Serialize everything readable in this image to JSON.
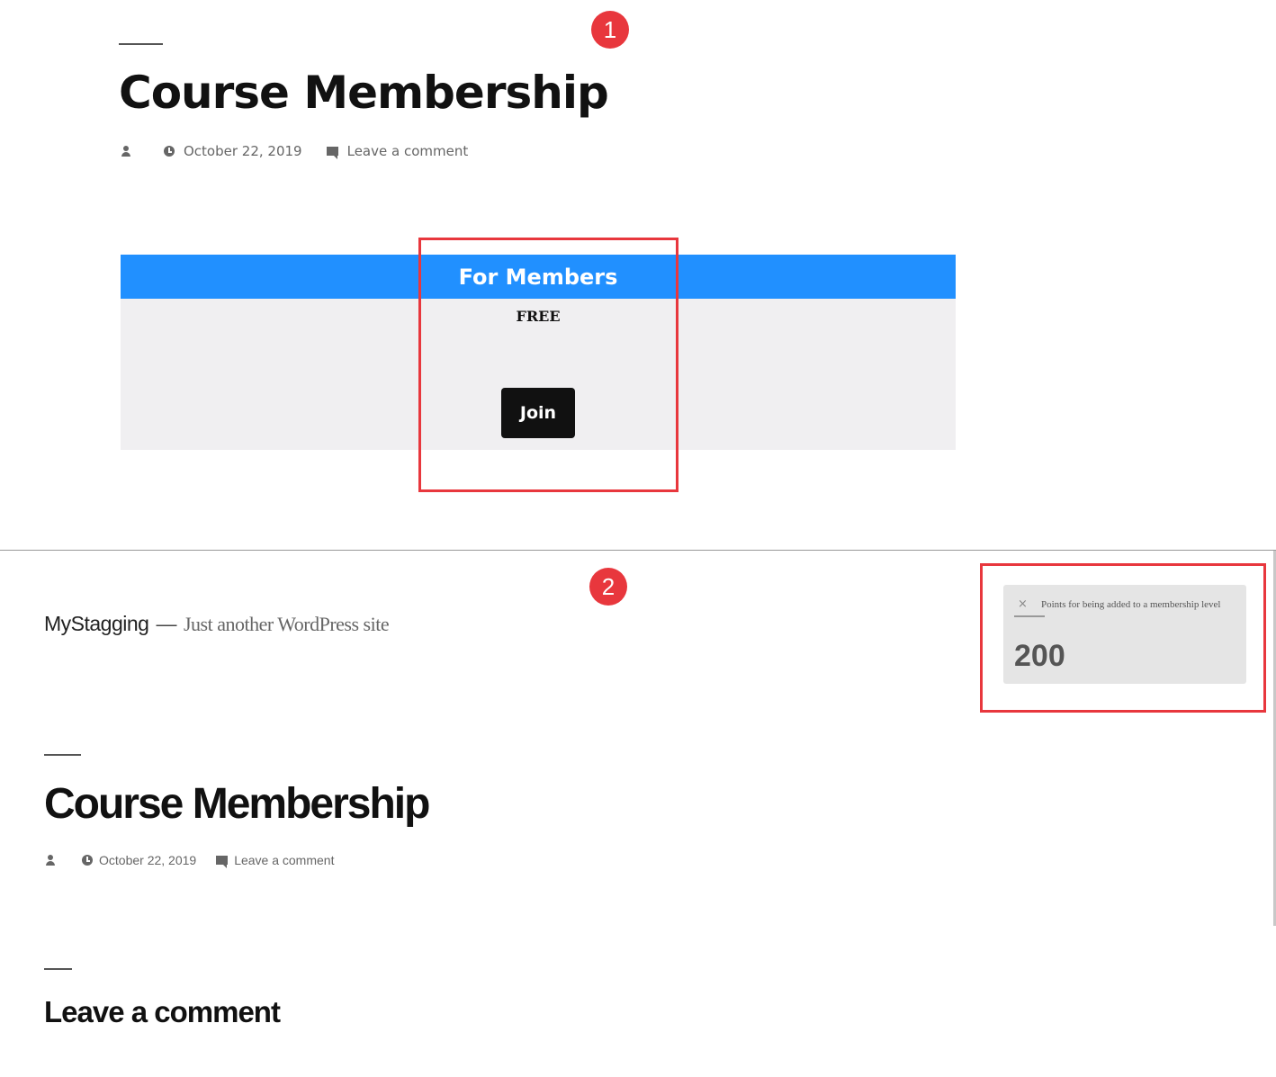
{
  "top_post": {
    "title": "Course Membership",
    "meta": {
      "date": "October 22, 2019",
      "comment_link": "Leave a comment"
    }
  },
  "membership_level": {
    "heading": "For Members",
    "price": "FREE",
    "join_label": "Join"
  },
  "callouts": {
    "first": "1",
    "second": "2"
  },
  "site": {
    "name": "MyStagging",
    "separator": "—",
    "tagline": "Just another WordPress site"
  },
  "points_notice": {
    "close_symbol": "×",
    "message": "Points for being added to a membership level",
    "points": "200"
  },
  "bottom_post": {
    "title": "Course Membership",
    "meta": {
      "date": "October 22, 2019",
      "comment_link": "Leave a comment"
    },
    "comments_heading": "Leave a comment"
  },
  "colors": {
    "accent_blue": "#2190ff",
    "callout_red": "#e8373d",
    "button_black": "#111111"
  },
  "icons": [
    "person-icon",
    "clock-icon",
    "comment-icon",
    "close-icon"
  ]
}
